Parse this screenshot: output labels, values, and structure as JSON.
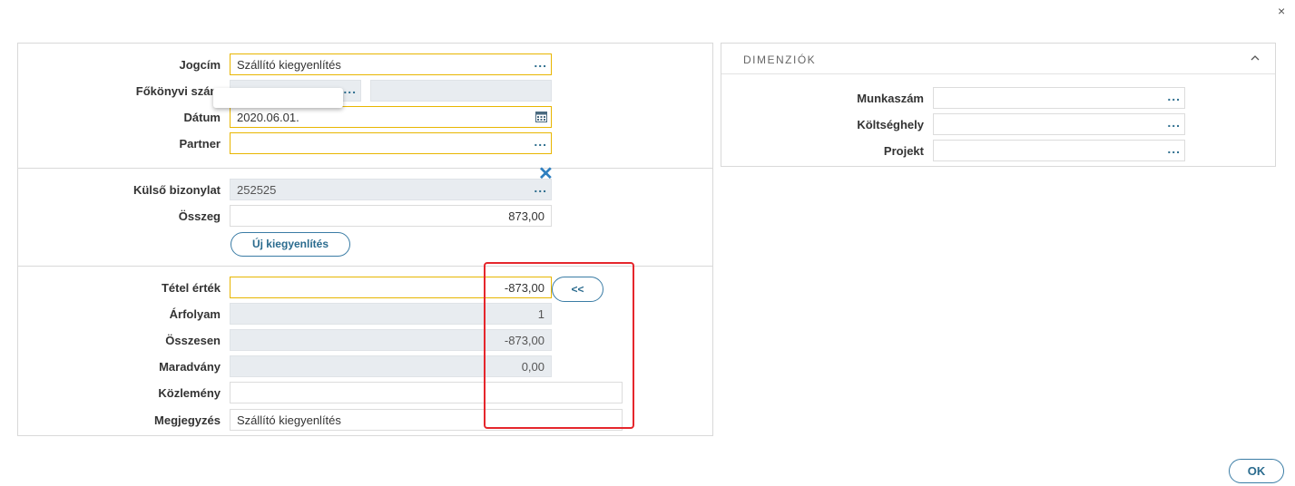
{
  "window": {
    "close_symbol": "×"
  },
  "form": {
    "jogcim": {
      "label": "Jogcím",
      "value": "Szállító kiegyenlítés"
    },
    "fokonyvi_szam": {
      "label": "Főkönyvi szám",
      "value": "",
      "value2": ""
    },
    "datum": {
      "label": "Dátum",
      "value": "2020.06.01."
    },
    "partner": {
      "label": "Partner",
      "value": ""
    },
    "kulso_bizonylat": {
      "label": "Külső bizonylat",
      "value": "252525"
    },
    "osszeg": {
      "label": "Összeg",
      "value": "873,00"
    },
    "uj_kiegyenlites": {
      "label": "Új kiegyenlítés"
    },
    "tetel_ertek": {
      "label": "Tétel érték",
      "value": "-873,00"
    },
    "copy_button": {
      "label": "<<"
    },
    "arfolyam": {
      "label": "Árfolyam",
      "value": "1"
    },
    "osszesen": {
      "label": "Összesen",
      "value": "-873,00"
    },
    "maradvany": {
      "label": "Maradvány",
      "value": "0,00"
    },
    "kozlemeny": {
      "label": "Közlemény",
      "value": ""
    },
    "megjegyzes": {
      "label": "Megjegyzés",
      "value": "Szállító kiegyenlítés"
    }
  },
  "dimensions": {
    "title": "DIMENZIÓK",
    "munkaszam": {
      "label": "Munkaszám",
      "value": ""
    },
    "koltseghely": {
      "label": "Költséghely",
      "value": ""
    },
    "projekt": {
      "label": "Projekt",
      "value": ""
    }
  },
  "footer": {
    "ok_label": "OK"
  },
  "colors": {
    "accent": "#2a6b8e",
    "required_border": "#e8b600",
    "highlight": "#e5262c"
  }
}
